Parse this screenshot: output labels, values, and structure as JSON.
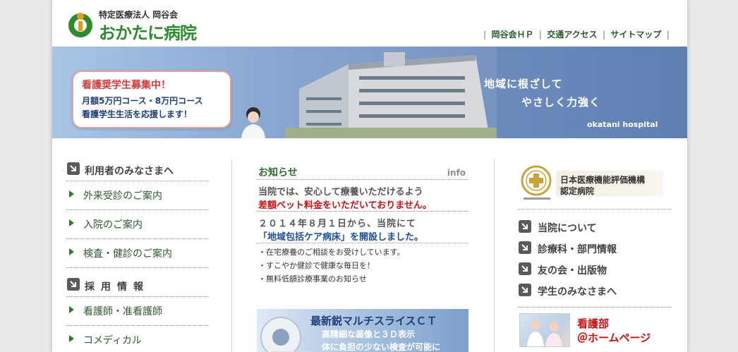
{
  "header": {
    "logo_subtitle": "特定医療法人 岡谷会",
    "logo_name": "おかたに病院",
    "nav": [
      {
        "label": "岡谷会ＨＰ"
      },
      {
        "label": "交通アクセス"
      },
      {
        "label": "サイトマップ"
      }
    ],
    "nav_separator": "|"
  },
  "banner": {
    "callout_title": "看護奨学生募集中！",
    "callout_line1": "月額5万円コース・8万円コース",
    "callout_line2": "看護学生生活を応援します！",
    "slogan_line1": "地域に根ざして",
    "slogan_line2": "やさしく力強く",
    "brand": "okatani hospital"
  },
  "left": {
    "section1_title": "利用者のみなさまへ",
    "section1_items": [
      {
        "label": "外来受診のご案内"
      },
      {
        "label": "入院のご案内"
      },
      {
        "label": "検査・健診のご案内"
      }
    ],
    "section2_title": "採用情報",
    "section2_items": [
      {
        "label": "看護師・准看護師"
      },
      {
        "label": "コメディカル"
      }
    ]
  },
  "center": {
    "info_title": "お知らせ",
    "info_tag": "info",
    "notice1_line1": "当院では、安心して療養いただけるよう",
    "notice1_line2": "差額ベット料金をいただいておりません。",
    "notice2_line1": "２０１４年８月１日から、当院にて",
    "notice2_line2": "「地域包括ケア病床」を開設しました。",
    "notices": [
      {
        "text": "・在宅療養のご相談をお受けしています。"
      },
      {
        "text": "・すこやか健診で健康な毎日を！"
      },
      {
        "text": "・無料低額診療事業のお知らせ"
      }
    ],
    "ct_title": "最新鋭マルチスライスＣＴ",
    "ct_line1": "高精細な画像と３Ｄ表示",
    "ct_line2": "体に負担の少ない検査が可能に"
  },
  "right": {
    "cert_line1": "日本医療機能評価機構",
    "cert_line2": "認定病院",
    "links": [
      {
        "label": "当院について"
      },
      {
        "label": "診療科・部門情報"
      },
      {
        "label": "友の会・出版物"
      },
      {
        "label": "学生のみなさまへ"
      }
    ],
    "nurse_line1": "看護部",
    "nurse_line2": "＠ホームページ"
  },
  "colors": {
    "brand_green": "#2e8b2e",
    "accent_red": "#cc1111",
    "link_blue": "#1d4f9a"
  }
}
